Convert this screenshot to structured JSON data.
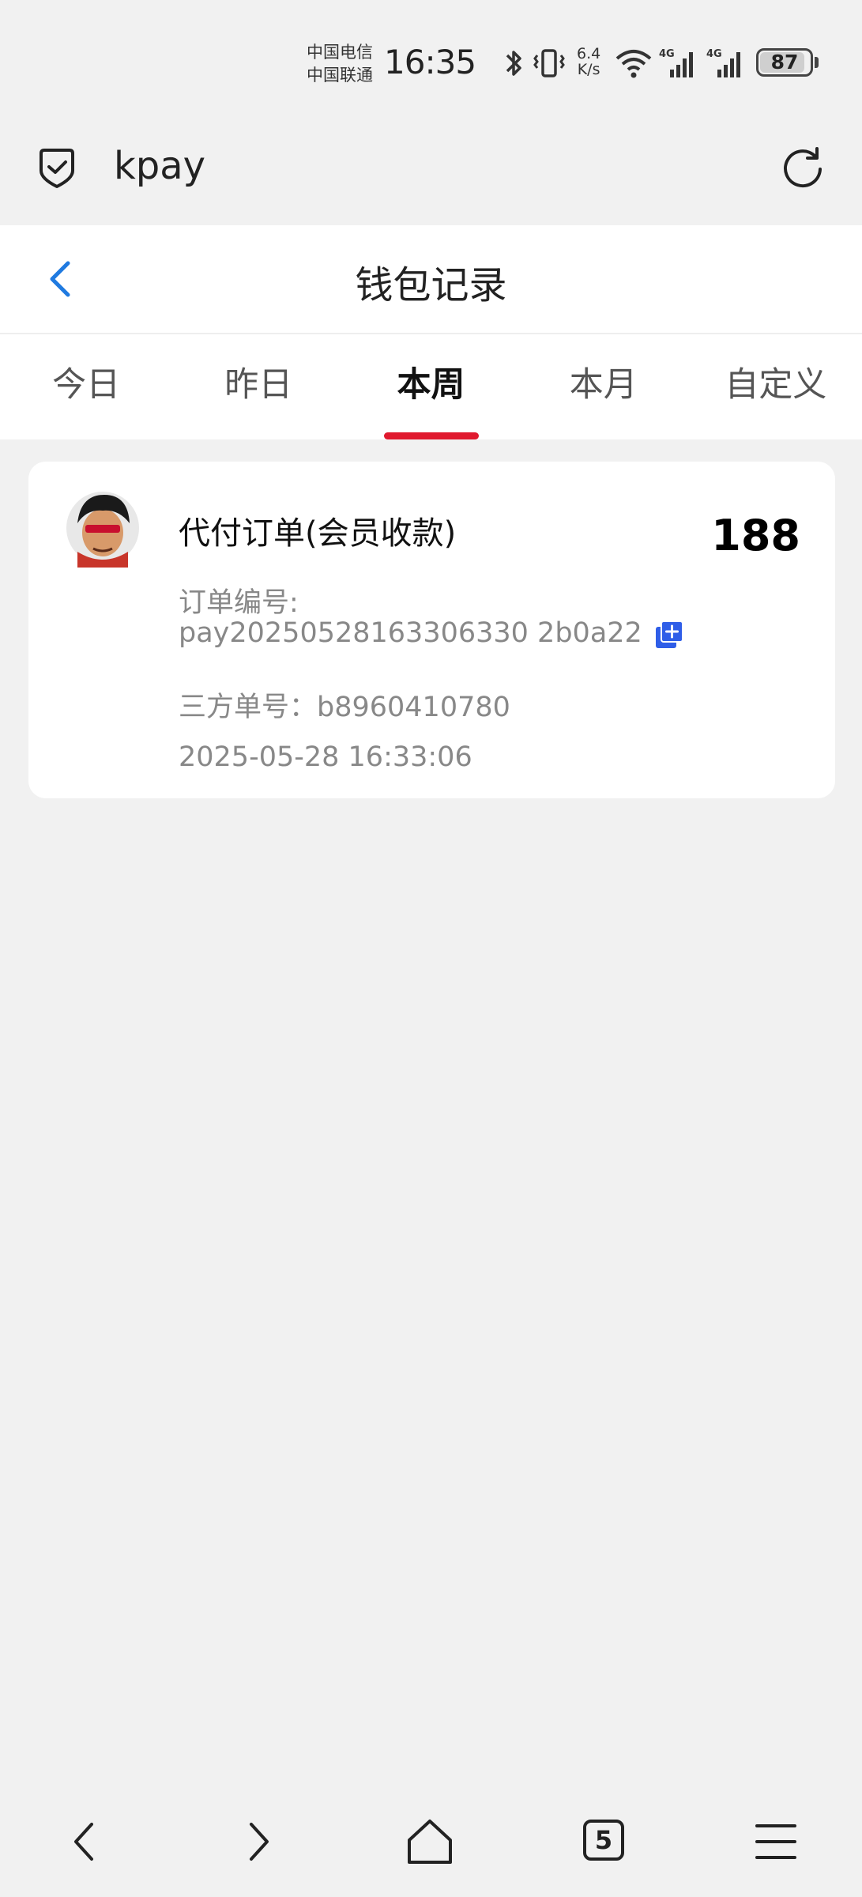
{
  "status_bar": {
    "carrier_1": "中国电信",
    "carrier_2": "中国联通",
    "time": "16:35",
    "net_speed_value": "6.4",
    "net_speed_unit": "K/s",
    "signal_1": "4G",
    "signal_2": "4G",
    "battery": "87"
  },
  "browser": {
    "url": "kpay",
    "security_icon": "shield-check-icon",
    "reload_icon": "refresh-icon"
  },
  "header": {
    "title": "钱包记录",
    "back_icon": "chevron-left-icon"
  },
  "tabs": [
    {
      "label": "今日",
      "active": false
    },
    {
      "label": "昨日",
      "active": false
    },
    {
      "label": "本周",
      "active": true
    },
    {
      "label": "本月",
      "active": false
    },
    {
      "label": "自定义",
      "active": false
    }
  ],
  "records": [
    {
      "title": "代付订单(会员收款)",
      "amount": "188",
      "order_label": "订单编号:",
      "order_no": "pay20250528163306330 2b0a22",
      "third_party": "三方单号：b8960410780",
      "datetime": "2025-05-28 16:33:06"
    }
  ],
  "bottom_nav": {
    "tab_count": "5",
    "icons": [
      "back-icon",
      "forward-icon",
      "home-icon",
      "tabs-icon",
      "menu-icon"
    ]
  },
  "colors": {
    "accent_red": "#e0192e",
    "link_blue": "#1f7ae0",
    "copy_blue": "#2f5ee8"
  }
}
